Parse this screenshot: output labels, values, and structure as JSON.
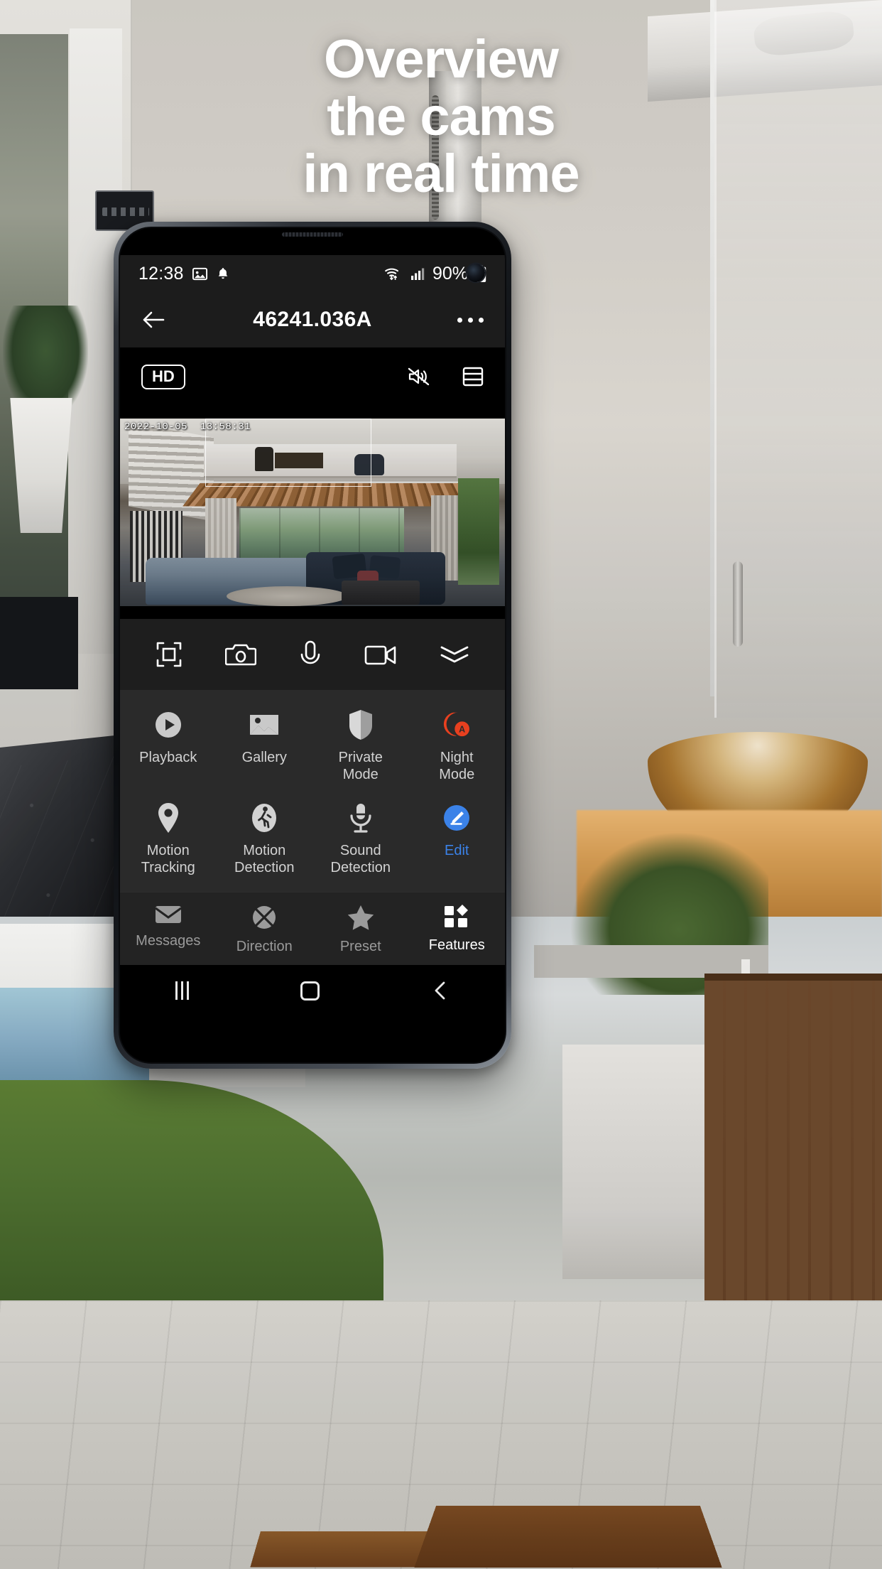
{
  "marketing": {
    "headline_line1": "Overview",
    "headline_line2": "the cams",
    "headline_line3": "in real time"
  },
  "colors": {
    "accent_blue": "#3b82e8",
    "night_mode_red": "#e8401f",
    "screen_bg": "#1c1c1c",
    "panel_bg": "#2a2a2a",
    "tab_bg": "#232323",
    "label_gray": "#d2d2d2"
  },
  "status_bar": {
    "time": "12:38",
    "left_icons": [
      "image-icon",
      "bell-icon"
    ],
    "wifi_icon": "wifi-transfer-icon",
    "signal_icon": "cellular-signal-icon",
    "battery_percent": "90%",
    "battery_icon": "battery-icon"
  },
  "app_header": {
    "back_icon": "back-arrow-icon",
    "title": "46241.036A",
    "menu_icon": "overflow-menu-icon"
  },
  "media_toolbar": {
    "quality_badge": "HD",
    "mute_icon": "speaker-muted-icon",
    "layout_icon": "split-layout-icon"
  },
  "video": {
    "timestamp_date": "2022-10-05",
    "timestamp_time": "13:58:31"
  },
  "control_bar": {
    "items": [
      {
        "name": "fit-screen-icon",
        "label": "Fit screen"
      },
      {
        "name": "snapshot-camera-icon",
        "label": "Snapshot"
      },
      {
        "name": "microphone-icon",
        "label": "Talk"
      },
      {
        "name": "record-video-icon",
        "label": "Record"
      },
      {
        "name": "collapse-chevrons-icon",
        "label": "Collapse"
      }
    ]
  },
  "features": {
    "row1": [
      {
        "label": "Playback",
        "icon": "play-circle-icon"
      },
      {
        "label": "Gallery",
        "icon": "gallery-image-icon"
      },
      {
        "label": "Private\nMode",
        "label_l1": "Private",
        "label_l2": "Mode",
        "icon": "privacy-shield-icon"
      },
      {
        "label": "Night\nMode",
        "label_l1": "Night",
        "label_l2": "Mode",
        "icon": "night-mode-auto-icon"
      }
    ],
    "row2": [
      {
        "label_l1": "Motion",
        "label_l2": "Tracking",
        "icon": "location-pin-icon"
      },
      {
        "label_l1": "Motion",
        "label_l2": "Detection",
        "icon": "walking-person-icon"
      },
      {
        "label_l1": "Sound",
        "label_l2": "Detection",
        "icon": "sound-mic-icon"
      },
      {
        "label_l1": "Edit",
        "label_l2": "",
        "icon": "edit-pencil-icon"
      }
    ]
  },
  "bottom_tabs": [
    {
      "label": "Messages",
      "icon": "envelope-icon",
      "active": false
    },
    {
      "label": "Direction",
      "icon": "direction-pad-icon",
      "active": false
    },
    {
      "label": "Preset",
      "icon": "star-icon",
      "active": false
    },
    {
      "label": "Features",
      "icon": "grid-features-icon",
      "active": true
    }
  ],
  "android_nav": {
    "recents_icon": "recents-icon",
    "home_icon": "home-icon",
    "back_icon": "nav-back-icon"
  }
}
